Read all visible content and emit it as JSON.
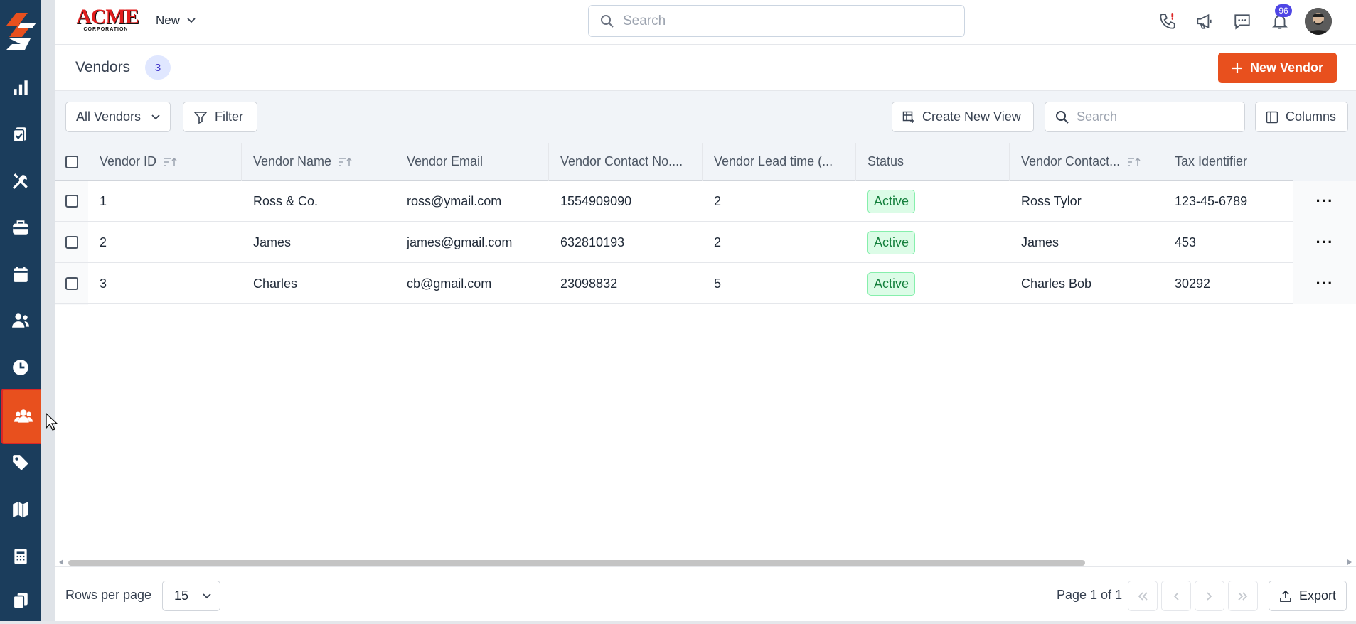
{
  "app": {
    "brand_big": "ACME",
    "brand_small": "CORPORATION",
    "new_menu_label": "New",
    "search_placeholder": "Search",
    "notification_count": "96"
  },
  "colors": {
    "sidebar": "#1b3d5c",
    "accent": "#e8501e",
    "status_active_bg": "#dcfce7",
    "status_active_text": "#15803d",
    "badge": "#4f46e5"
  },
  "sidebar": {
    "items": [
      {
        "icon": "bar-chart-icon",
        "active": false
      },
      {
        "icon": "clipboard-check-icon",
        "active": false
      },
      {
        "icon": "tools-icon",
        "active": false
      },
      {
        "icon": "briefcase-icon",
        "active": false
      },
      {
        "icon": "calendar-icon",
        "active": false
      },
      {
        "icon": "users-icon",
        "active": false
      },
      {
        "icon": "clock-icon",
        "active": false
      },
      {
        "icon": "vendors-group-icon",
        "active": true
      },
      {
        "icon": "tag-icon",
        "active": false
      },
      {
        "icon": "map-icon",
        "active": false
      },
      {
        "icon": "calculator-icon",
        "active": false
      },
      {
        "icon": "files-icon",
        "active": false
      }
    ]
  },
  "header": {
    "title": "Vendors",
    "count": "3",
    "new_button_label": "New Vendor"
  },
  "toolbar": {
    "view_select": "All Vendors",
    "filter_label": "Filter",
    "create_view_label": "Create New View",
    "search_placeholder": "Search",
    "columns_label": "Columns"
  },
  "table": {
    "columns": [
      "Vendor ID",
      "Vendor Name",
      "Vendor Email",
      "Vendor Contact No....",
      "Vendor Lead time (...",
      "Status",
      "Vendor Contact...",
      "Tax Identifier"
    ],
    "rows": [
      {
        "id": "1",
        "name": "Ross & Co.",
        "email": "ross@ymail.com",
        "contact_no": "1554909090",
        "lead_time": "2",
        "status": "Active",
        "contact": "Ross Tylor",
        "tax_id": "123-45-6789"
      },
      {
        "id": "2",
        "name": "James",
        "email": "james@gmail.com",
        "contact_no": "632810193",
        "lead_time": "2",
        "status": "Active",
        "contact": "James",
        "tax_id": "453"
      },
      {
        "id": "3",
        "name": "Charles",
        "email": "cb@gmail.com",
        "contact_no": "23098832",
        "lead_time": "5",
        "status": "Active",
        "contact": "Charles Bob",
        "tax_id": "30292"
      }
    ],
    "row_actions_label": "···"
  },
  "footer": {
    "rows_per_page_label": "Rows per page",
    "rows_per_page_value": "15",
    "page_info": "Page 1 of 1",
    "export_label": "Export"
  }
}
